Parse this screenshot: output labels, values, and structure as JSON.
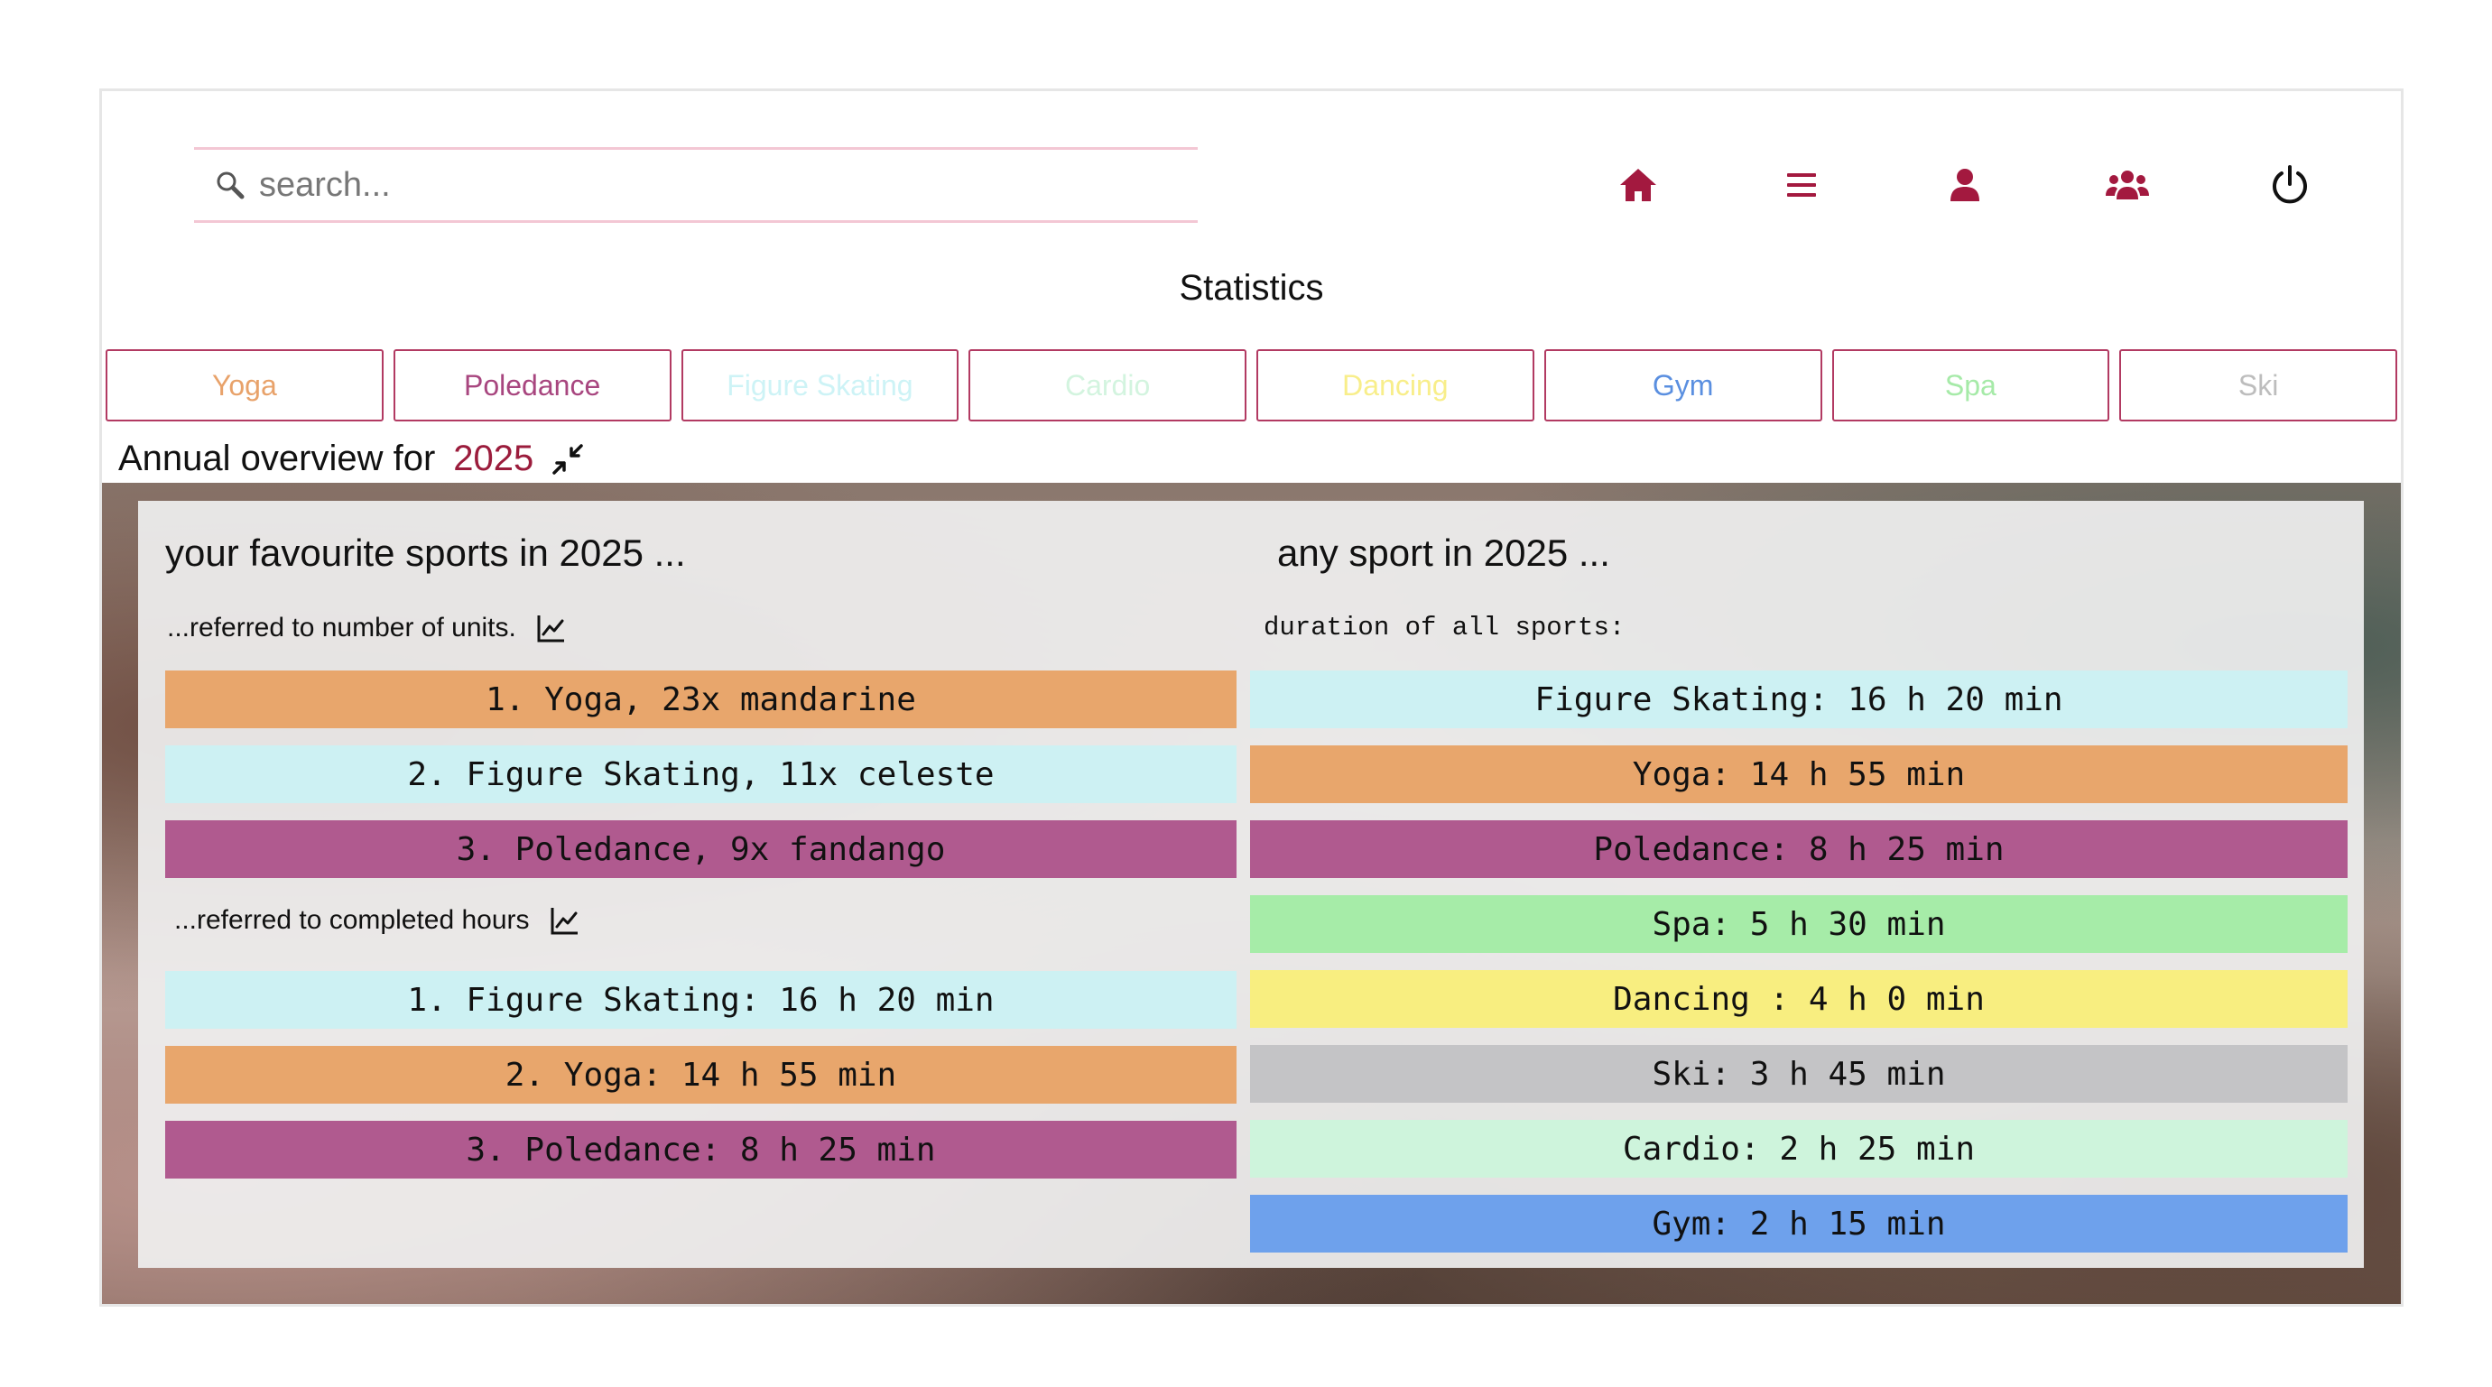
{
  "search": {
    "placeholder": "search..."
  },
  "nav": [
    {
      "name": "home-icon",
      "color": "#a3193f"
    },
    {
      "name": "menu-icon",
      "color": "#a3193f"
    },
    {
      "name": "user-icon",
      "color": "#a3193f"
    },
    {
      "name": "group-icon",
      "color": "#a3193f"
    },
    {
      "name": "power-icon",
      "color": "#111111"
    }
  ],
  "page_title": "Statistics",
  "tabs": [
    {
      "label": "Yoga",
      "color": "#e8a26a"
    },
    {
      "label": "Poledance",
      "color": "#a8467f"
    },
    {
      "label": "Figure Skating",
      "color": "#cdf3f6"
    },
    {
      "label": "Cardio",
      "color": "#d3f4df"
    },
    {
      "label": "Dancing",
      "color": "#f8ee8a"
    },
    {
      "label": "Gym",
      "color": "#5a8fe0"
    },
    {
      "label": "Spa",
      "color": "#a6eaa8"
    },
    {
      "label": "Ski",
      "color": "#bdbdbd"
    }
  ],
  "overview": {
    "label": "Annual overview for",
    "year": "2025"
  },
  "left": {
    "heading": "your favourite sports in 2025 ...",
    "units_sub": "...referred to number of units.",
    "units": [
      {
        "text": "1. Yoga, 23x mandarine",
        "color": "#e8a66c"
      },
      {
        "text": "2. Figure Skating, 11x celeste",
        "color": "#cdf1f3"
      },
      {
        "text": "3. Poledance, 9x fandango",
        "color": "#b05a8f"
      }
    ],
    "hours_sub": "...referred to completed hours",
    "hours": [
      {
        "text": "1. Figure Skating: 16 h 20 min",
        "color": "#cdf1f3"
      },
      {
        "text": "2. Yoga: 14 h 55 min",
        "color": "#e8a66c"
      },
      {
        "text": "3. Poledance: 8 h 25 min",
        "color": "#b05a8f"
      }
    ]
  },
  "right": {
    "heading": "any sport in 2025 ...",
    "sub": "duration of all sports:",
    "items": [
      {
        "text": "Figure Skating: 16 h 20 min",
        "color": "#cdf1f3"
      },
      {
        "text": "Yoga: 14 h 55 min",
        "color": "#e8a66c"
      },
      {
        "text": "Poledance: 8 h 25 min",
        "color": "#b05a8f"
      },
      {
        "text": "Spa: 5 h 30 min",
        "color": "#a6eca8"
      },
      {
        "text": "Dancing : 4 h 0 min",
        "color": "#f8ee80"
      },
      {
        "text": "Ski: 3 h 45 min",
        "color": "#c4c4c6"
      },
      {
        "text": "Cardio: 2 h 25 min",
        "color": "#cef4dc"
      },
      {
        "text": "Gym: 2 h 15 min",
        "color": "#6ea1ec"
      }
    ]
  }
}
